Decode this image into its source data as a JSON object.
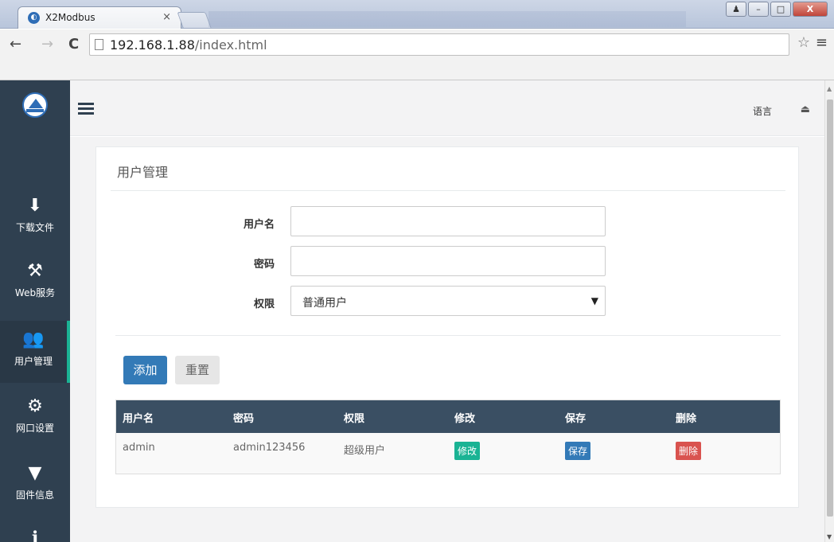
{
  "browser": {
    "tab_title": "X2Modbus",
    "tab_close": "×",
    "url_host": "192.168.1.88",
    "url_path": "/index.html",
    "window_controls": [
      "minimize",
      "maximize",
      "close"
    ]
  },
  "sidebar": {
    "items": [
      {
        "label": "下载文件",
        "icon": "download-icon"
      },
      {
        "label": "Web服务",
        "icon": "hammer-icon"
      },
      {
        "label": "用户管理",
        "icon": "users-icon",
        "active": true
      },
      {
        "label": "网口设置",
        "icon": "gear-icon"
      },
      {
        "label": "固件信息",
        "icon": "filter-icon"
      },
      {
        "label": "",
        "icon": "info-icon"
      }
    ]
  },
  "topbar": {
    "lang_label": "语言"
  },
  "page": {
    "title": "用户管理",
    "form": {
      "username_label": "用户名",
      "password_label": "密码",
      "permission_label": "权限",
      "permission_value": "普通用户",
      "username_value": "",
      "password_value": ""
    },
    "buttons": {
      "add": "添加",
      "reset": "重置"
    },
    "table": {
      "headers": [
        "用户名",
        "密码",
        "权限",
        "修改",
        "保存",
        "删除"
      ],
      "rows": [
        {
          "username": "admin",
          "password": "admin123456",
          "permission": "超级用户",
          "edit": "修改",
          "save": "保存",
          "delete": "删除"
        }
      ]
    }
  },
  "colors": {
    "sidebar_bg": "#2f4050",
    "active_accent": "#1ab394",
    "primary": "#337ab7",
    "danger": "#d9534f",
    "table_header": "#3a4f63"
  }
}
